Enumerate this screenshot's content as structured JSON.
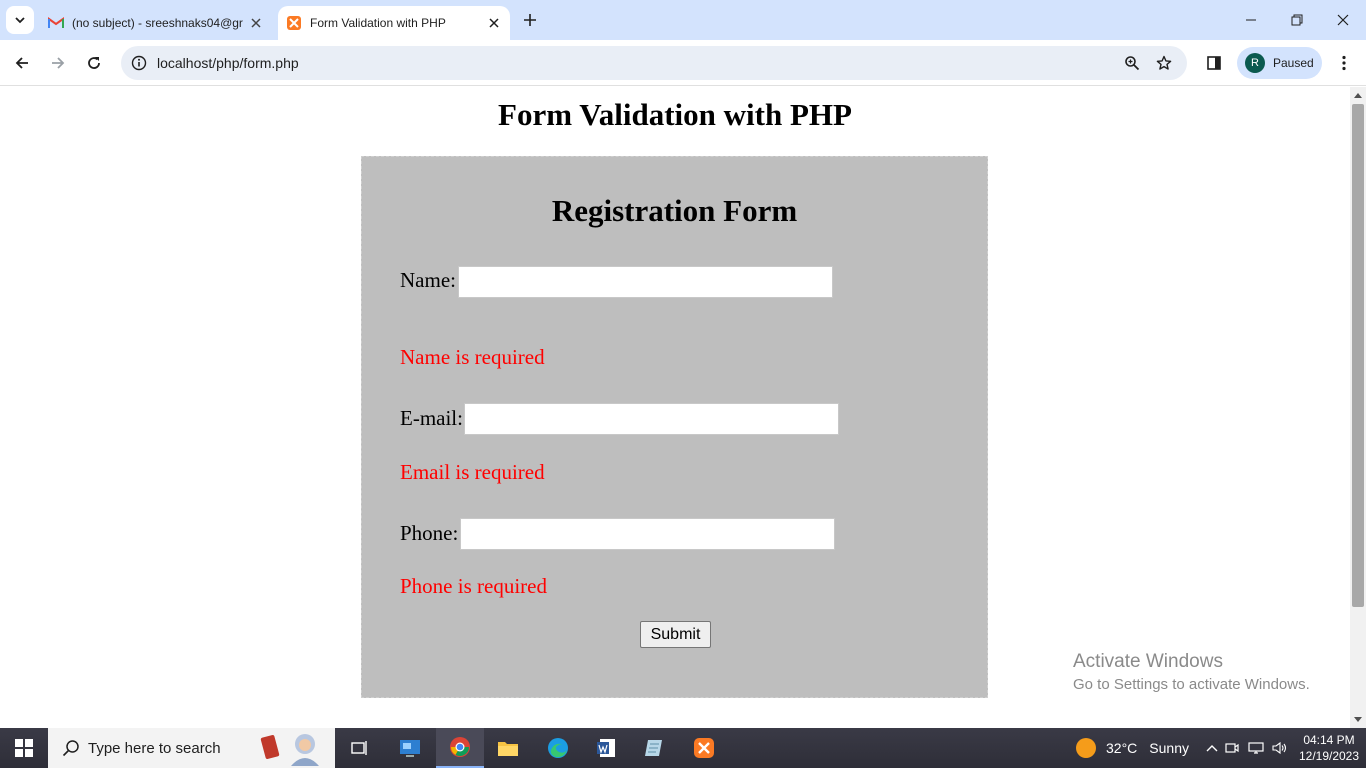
{
  "browser": {
    "tabs": [
      {
        "title": "(no subject) - sreeshnaks04@gr",
        "icon": "gmail-icon"
      },
      {
        "title": "Form Validation with PHP",
        "icon": "xampp-icon"
      }
    ],
    "url": "localhost/php/form.php",
    "profile_initial": "R",
    "profile_status": "Paused"
  },
  "page": {
    "title": "Form Validation with PHP",
    "form": {
      "heading": "Registration Form",
      "name_label": "Name:",
      "name_value": "",
      "name_error": "Name is required",
      "email_label": "E-mail:",
      "email_value": "",
      "email_error": "Email is required",
      "phone_label": "Phone:",
      "phone_value": "",
      "phone_error": "Phone is required",
      "submit_label": "Submit"
    }
  },
  "watermark": {
    "title": "Activate Windows",
    "subtitle": "Go to Settings to activate Windows."
  },
  "taskbar": {
    "search_placeholder": "Type here to search",
    "weather_temp": "32°C",
    "weather_text": "Sunny",
    "time": "04:14 PM",
    "date": "12/19/2023"
  },
  "colors": {
    "tabstrip": "#d3e3fd",
    "form_background": "#bebebe",
    "error_text": "#ff0000"
  }
}
